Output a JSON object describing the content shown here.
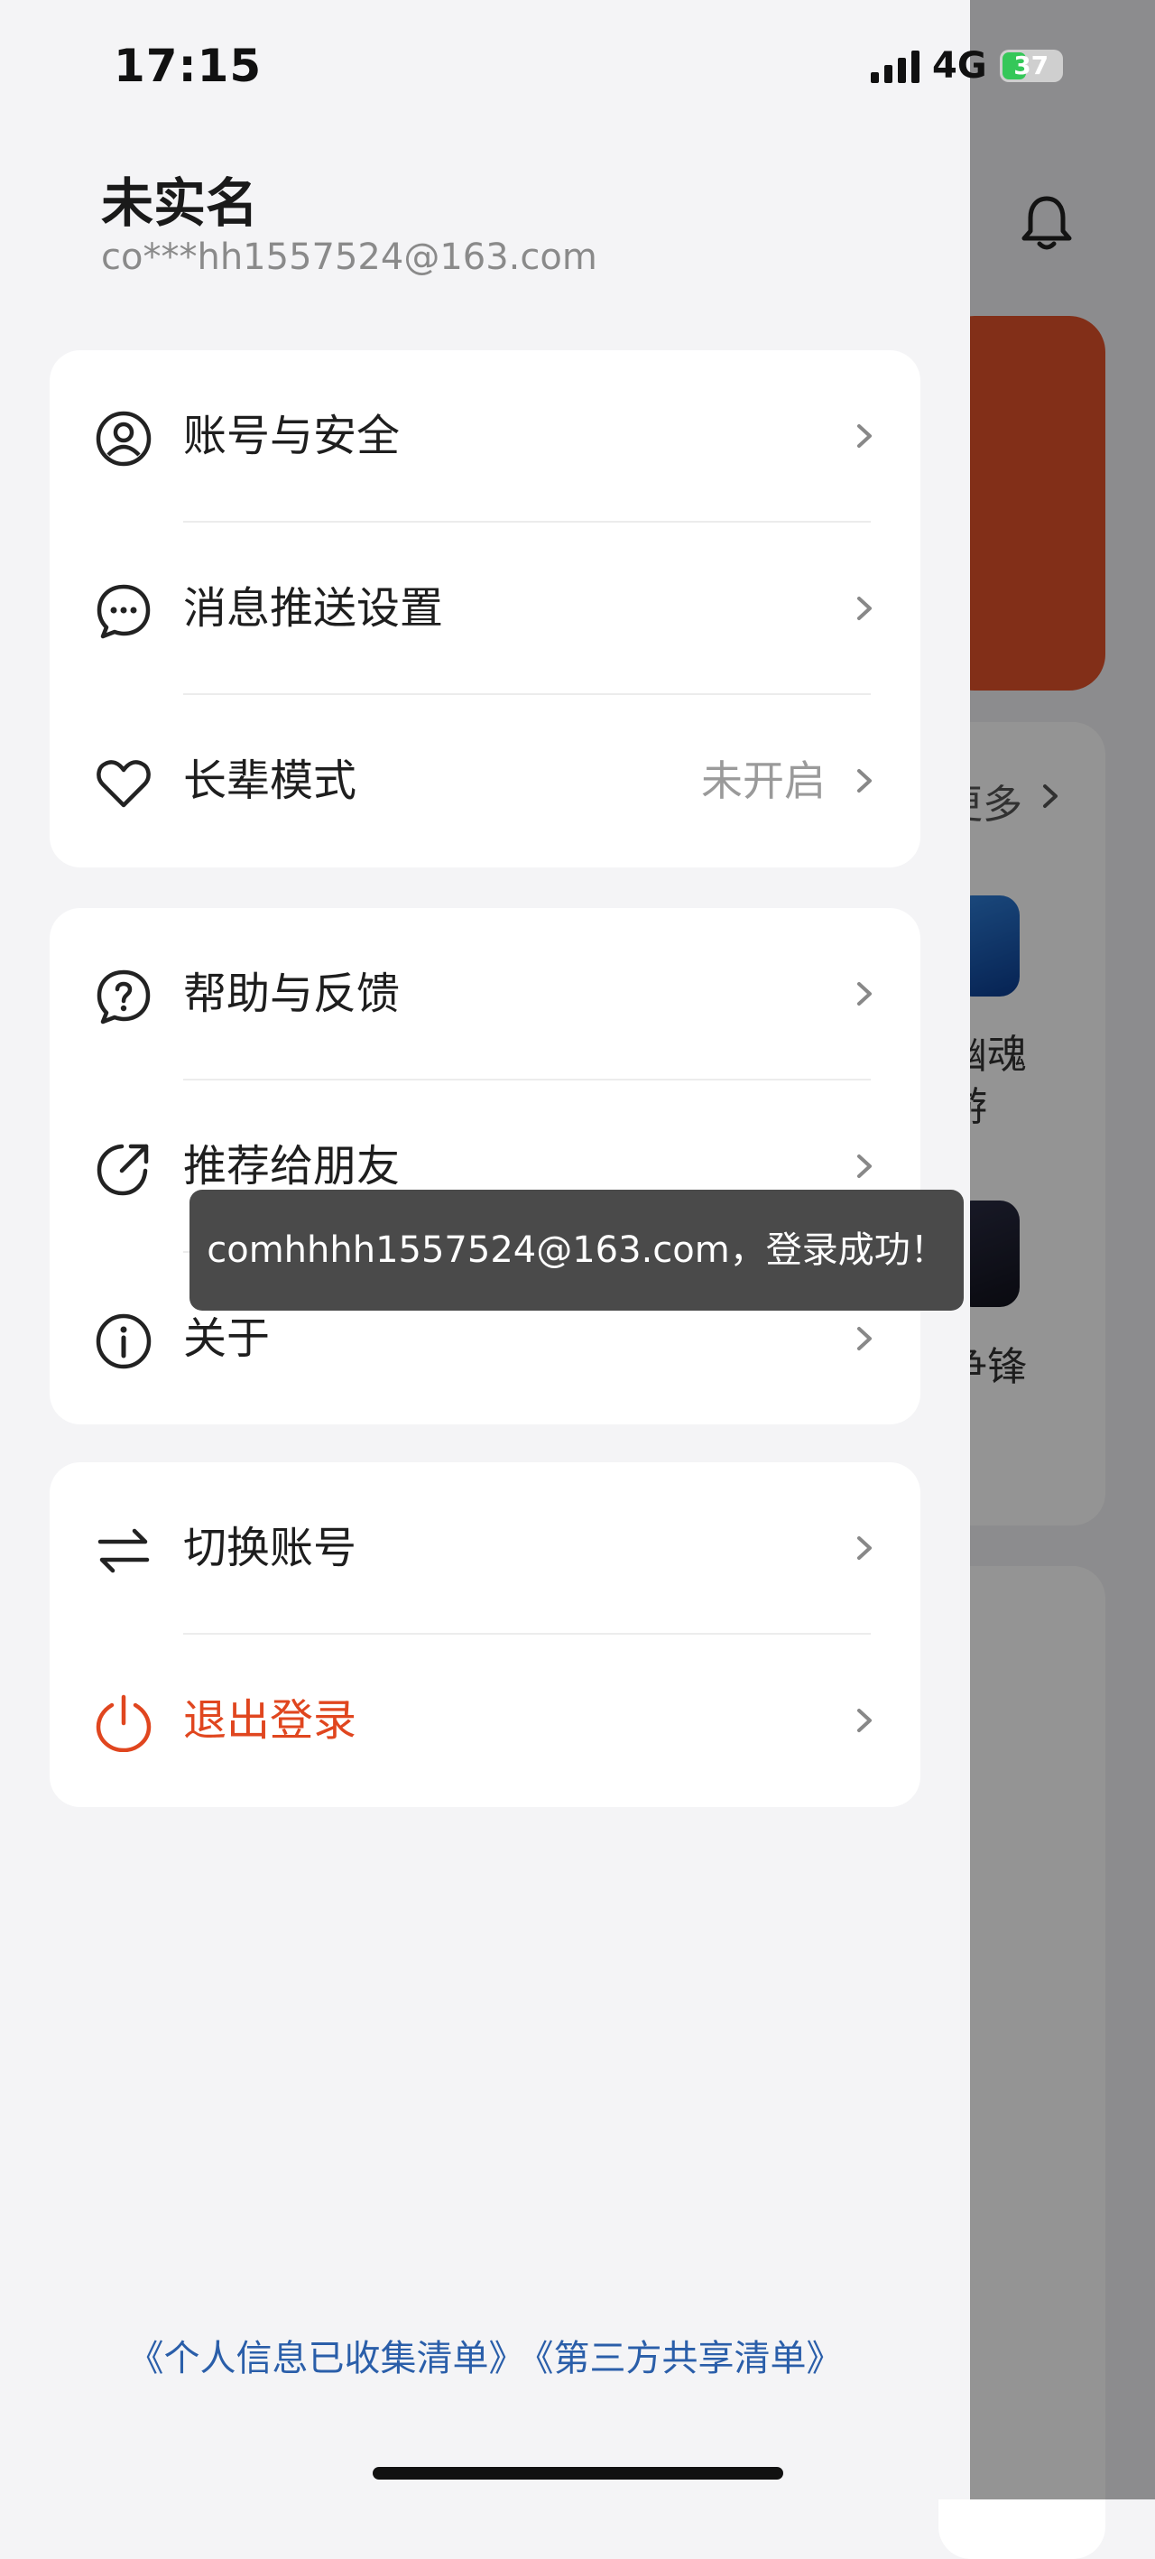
{
  "status_bar": {
    "time": "17:15",
    "network": "4G",
    "battery": "37"
  },
  "user": {
    "name": "未实名",
    "email": "co***hh1557524@163.com"
  },
  "menu_group_1": [
    {
      "label": "账号与安全",
      "icon": "user-circle-icon"
    },
    {
      "label": "消息推送设置",
      "icon": "message-bubble-icon"
    },
    {
      "label": "长辈模式",
      "value": "未开启",
      "icon": "heart-icon"
    }
  ],
  "menu_group_2": [
    {
      "label": "帮助与反馈",
      "icon": "help-bubble-icon"
    },
    {
      "label": "推荐给朋友",
      "icon": "share-icon"
    },
    {
      "label": "关于",
      "icon": "info-icon"
    }
  ],
  "menu_group_3": [
    {
      "label": "切换账号",
      "icon": "swap-icon"
    },
    {
      "label": "退出登录",
      "icon": "power-icon"
    }
  ],
  "toast": "comhhhh1557524@163.com，登录成功！",
  "footer": {
    "privacy_list": "《个人信息已收集清单》",
    "third_party_list": "《第三方共享清单》"
  },
  "background_app": {
    "more_label": "更多",
    "game_1": "幽魂",
    "game_1_line2": "游",
    "game_2": "争锋"
  },
  "colors": {
    "accent_red": "#e0461f",
    "link_blue": "#2a5ea9",
    "banner_orange": "#e0512a"
  }
}
